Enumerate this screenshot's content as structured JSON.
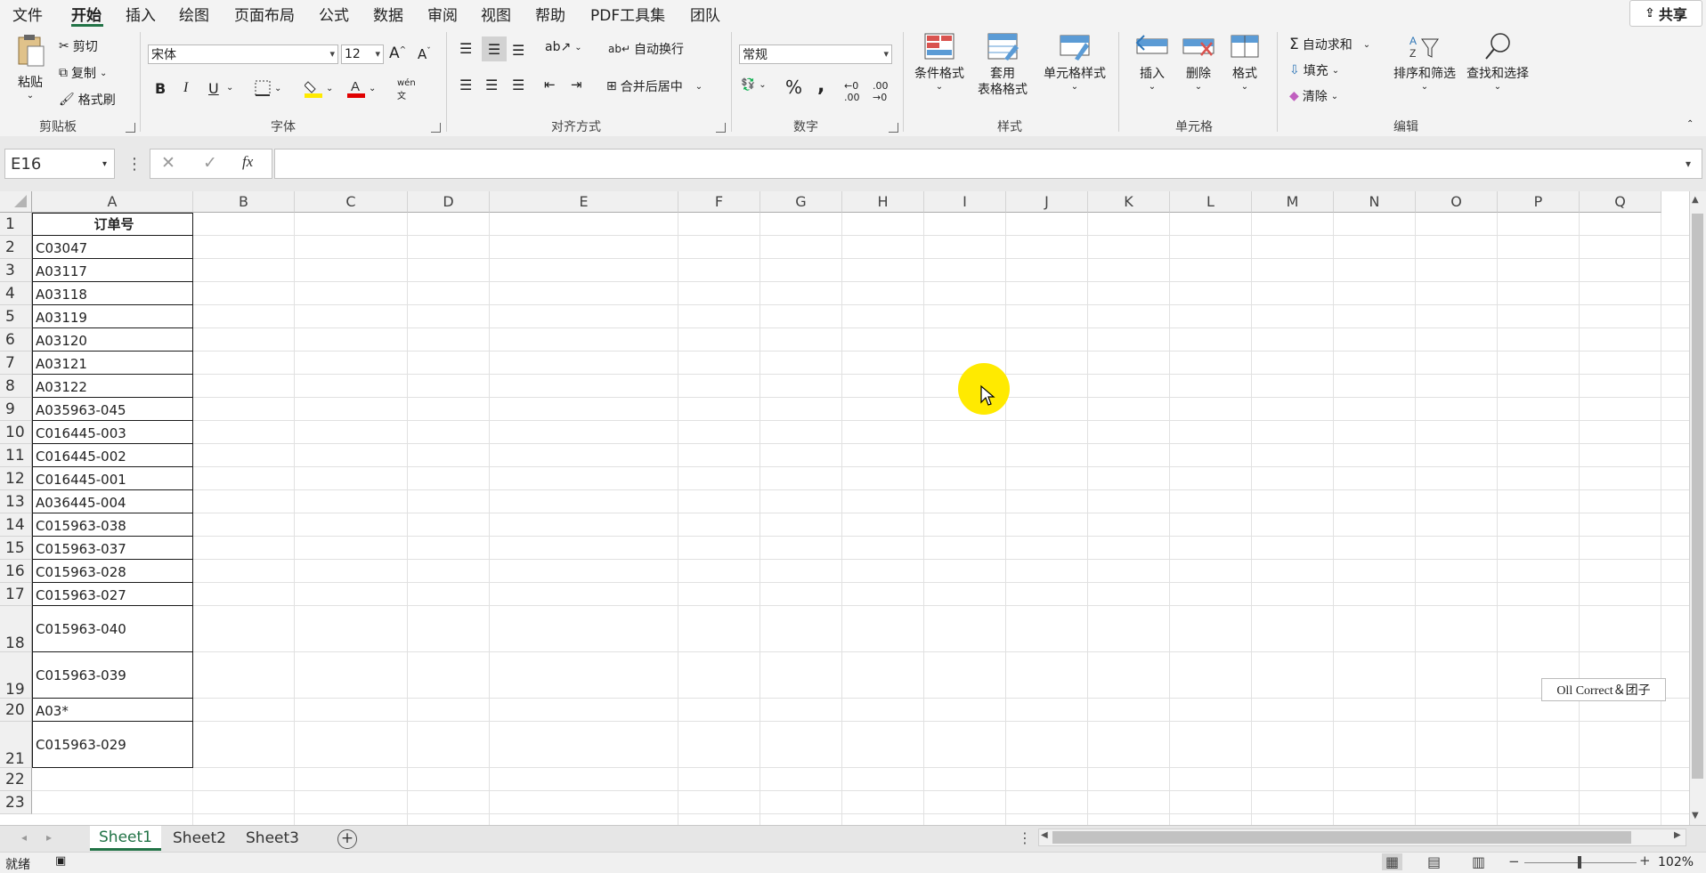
{
  "menu": {
    "tabs": [
      "文件",
      "开始",
      "插入",
      "绘图",
      "页面布局",
      "公式",
      "数据",
      "审阅",
      "视图",
      "帮助",
      "PDF工具集",
      "团队"
    ],
    "active": "开始",
    "share_label": "共享"
  },
  "ribbon": {
    "clipboard": {
      "paste": "粘贴",
      "cut": "剪切",
      "copy": "复制",
      "format_painter": "格式刷",
      "group": "剪贴板"
    },
    "font": {
      "name": "宋体",
      "size": "12",
      "group": "字体",
      "bold": "B",
      "italic": "I",
      "underline": "U"
    },
    "alignment": {
      "wrap": "自动换行",
      "merge": "合并后居中",
      "group": "对齐方式"
    },
    "number": {
      "format": "常规",
      "percent": "%",
      "comma": ",",
      "group": "数字"
    },
    "styles": {
      "conditional": "条件格式",
      "table_format_1": "套用",
      "table_format_2": "表格格式",
      "cell_styles": "单元格样式",
      "group": "样式"
    },
    "cells": {
      "insert": "插入",
      "delete": "删除",
      "format": "格式",
      "group": "单元格"
    },
    "editing": {
      "autosum": "自动求和",
      "fill": "填充",
      "clear": "清除",
      "sort_filter": "排序和筛选",
      "find_select": "查找和选择",
      "group": "编辑"
    }
  },
  "formula_bar": {
    "name_box": "E16",
    "fx": "fx",
    "content": ""
  },
  "columns": [
    "A",
    "B",
    "C",
    "D",
    "E",
    "F",
    "G",
    "H",
    "I",
    "J",
    "K",
    "L",
    "M",
    "N",
    "O",
    "P",
    "Q"
  ],
  "rows": [
    {
      "n": "1",
      "a": "订单号"
    },
    {
      "n": "2",
      "a": "C03047"
    },
    {
      "n": "3",
      "a": "A03117"
    },
    {
      "n": "4",
      "a": "A03118"
    },
    {
      "n": "5",
      "a": "A03119"
    },
    {
      "n": "6",
      "a": "A03120"
    },
    {
      "n": "7",
      "a": "A03121"
    },
    {
      "n": "8",
      "a": "A03122"
    },
    {
      "n": "9",
      "a": "A035963-045"
    },
    {
      "n": "10",
      "a": "C016445-003"
    },
    {
      "n": "11",
      "a": "C016445-002"
    },
    {
      "n": "12",
      "a": "C016445-001"
    },
    {
      "n": "13",
      "a": "A036445-004"
    },
    {
      "n": "14",
      "a": "C015963-038"
    },
    {
      "n": "15",
      "a": "C015963-037"
    },
    {
      "n": "16",
      "a": "C015963-028"
    },
    {
      "n": "17",
      "a": "C015963-027"
    },
    {
      "n": "18",
      "a": "C015963-040"
    },
    {
      "n": "19",
      "a": "C015963-039"
    },
    {
      "n": "20",
      "a": "A03*"
    },
    {
      "n": "21",
      "a": "C015963-029"
    },
    {
      "n": "22",
      "a": ""
    },
    {
      "n": "23",
      "a": ""
    }
  ],
  "sheets": [
    "Sheet1",
    "Sheet2",
    "Sheet3"
  ],
  "active_sheet": "Sheet1",
  "status": {
    "ready": "就绪",
    "zoom": "102%"
  },
  "watermark": "Oll Correct＆团子",
  "colors": {
    "accent": "#217346",
    "highlight": "#ffea00"
  }
}
